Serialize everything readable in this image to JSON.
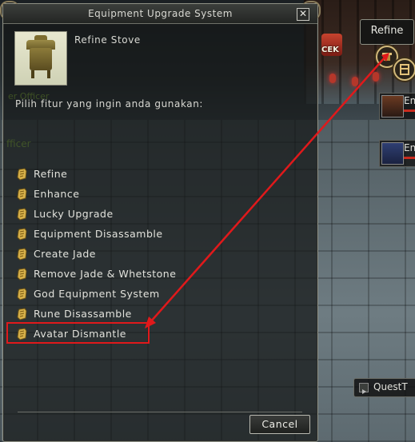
{
  "dialog": {
    "title": "Equipment Upgrade System",
    "close_label": "✕",
    "npc_name": "Refine Stove",
    "prompt": "Pilih fitur yang ingin anda gunakan:",
    "menu_items": [
      "Refine",
      "Enhance",
      "Lucky Upgrade",
      "Equipment Disassamble",
      "Create Jade",
      "Remove Jade & Whetstone",
      "God Equipment System",
      "Rune Disassamble",
      "Avatar Dismantle"
    ],
    "highlighted_item": "Avatar Dismantle",
    "cancel_label": "Cancel"
  },
  "background_text": {
    "ghost1": "er Officer",
    "ghost2": "fficer"
  },
  "hud": {
    "refine_button": "Refine",
    "cek_badge": "CEK",
    "party": [
      {
        "name": "En"
      },
      {
        "name": "En"
      }
    ],
    "quest_label": "QuestT"
  },
  "colors": {
    "highlight_box": "#e0191b",
    "annotation_arrow": "#e0191b",
    "dialog_text": "#d8d8d2"
  }
}
